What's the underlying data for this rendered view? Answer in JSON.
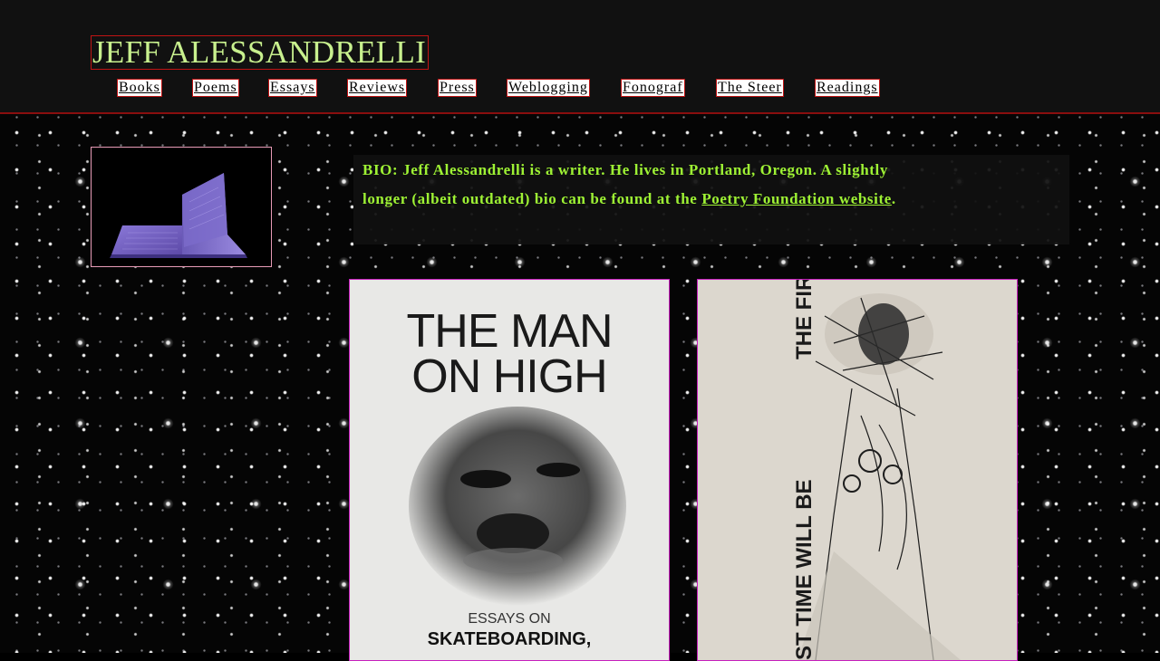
{
  "header": {
    "site_title": "JEFF ALESSANDRELLI"
  },
  "nav": {
    "items": [
      {
        "label": "Books"
      },
      {
        "label": "Poems"
      },
      {
        "label": "Essays"
      },
      {
        "label": "Reviews"
      },
      {
        "label": "Press"
      },
      {
        "label": "Weblogging"
      },
      {
        "label": "Fonograf"
      },
      {
        "label": "The Steer"
      },
      {
        "label": "Readings"
      }
    ]
  },
  "bio": {
    "text": "BIO: Jeff Alessandrelli is a writer. He lives in Portland, Oregon. A slightly longer (albeit outdated) bio can be found at the ",
    "link_label": "Poetry Foundation website",
    "trailing": "."
  },
  "covers": [
    {
      "title_line1": "THE MAN",
      "title_line2": "ON HIGH",
      "subtitle_line1": "ESSAYS ON",
      "subtitle_line2": "SKATEBOARDING,"
    },
    {
      "spine_top": "THE FIRST",
      "spine_bottom": "ST TIME WILL BE"
    }
  ],
  "colors": {
    "title_green": "#c8f08e",
    "bio_green": "#9ef234",
    "header_bg": "#111111",
    "accent_red": "#c01414",
    "cover_border": "#c61fbd"
  }
}
